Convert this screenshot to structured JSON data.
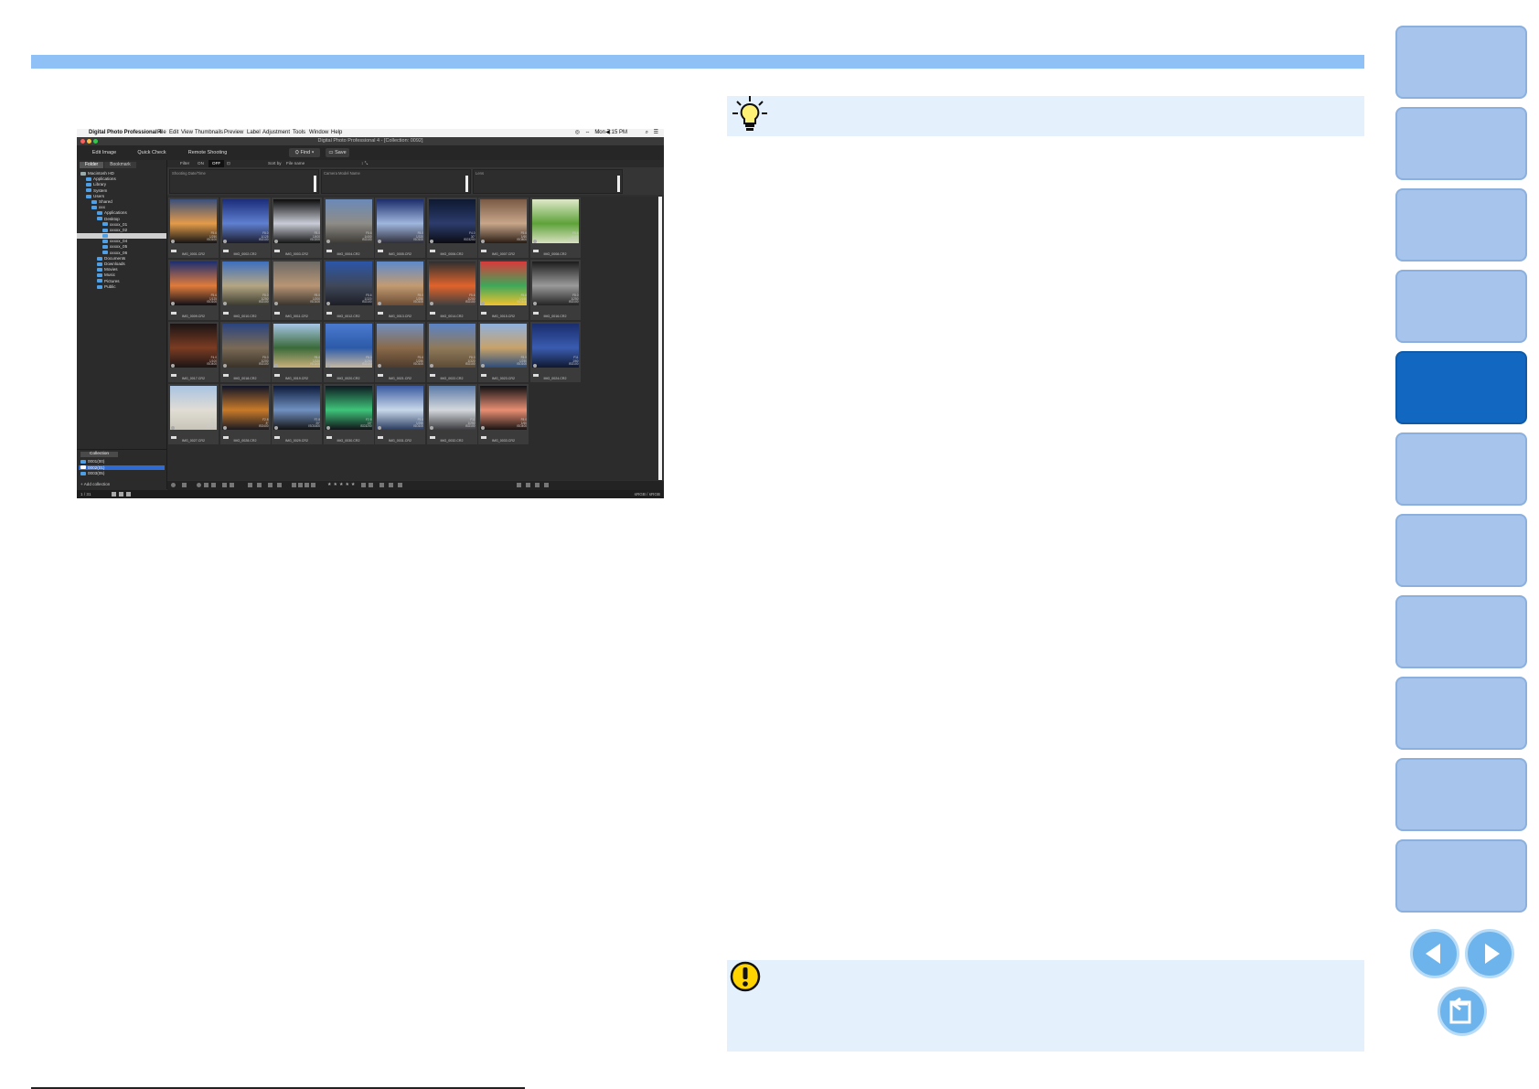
{
  "menubar": {
    "app_name": "Digital Photo Professional 4",
    "items": [
      "File",
      "Edit",
      "View",
      "Thumbnails",
      "Preview",
      "Label",
      "Adjustment",
      "Tools",
      "Window",
      "Help"
    ],
    "clock": "Mon 7:15 PM"
  },
  "window": {
    "title": "Digital Photo Professional 4 - [Collection: 0092]"
  },
  "toolbar": {
    "edit_image": "Edit Image",
    "quick_check": "Quick Check",
    "remote_shooting": "Remote Shooting",
    "find": "Find",
    "save": "Save"
  },
  "left_panel": {
    "tabs": [
      "Folder",
      "Bookmark"
    ],
    "tree": [
      {
        "label": "Macintosh HD",
        "indent": 0
      },
      {
        "label": "Applications",
        "indent": 1
      },
      {
        "label": "Library",
        "indent": 1
      },
      {
        "label": "System",
        "indent": 1
      },
      {
        "label": "Users",
        "indent": 1
      },
      {
        "label": "Shared",
        "indent": 2
      },
      {
        "label": "xxx",
        "indent": 2
      },
      {
        "label": "Applications",
        "indent": 3
      },
      {
        "label": "Desktop",
        "indent": 3
      },
      {
        "label": "xxxxx_01",
        "indent": 4
      },
      {
        "label": "xxxxx_02",
        "indent": 4
      },
      {
        "label": "",
        "indent": 4,
        "selected": true
      },
      {
        "label": "xxxxx_04",
        "indent": 4
      },
      {
        "label": "xxxxx_05",
        "indent": 4
      },
      {
        "label": "xxxxx_06",
        "indent": 4
      },
      {
        "label": "Documents",
        "indent": 3
      },
      {
        "label": "Downloads",
        "indent": 3
      },
      {
        "label": "Movies",
        "indent": 3
      },
      {
        "label": "Music",
        "indent": 3
      },
      {
        "label": "Pictures",
        "indent": 3
      },
      {
        "label": "Public",
        "indent": 3
      }
    ],
    "collection_tab": "Collection",
    "collections": [
      "0001(00)",
      "0002(01)",
      "0003(05)"
    ],
    "add_collection": "Add collection"
  },
  "filterbar": {
    "filter": "Filter",
    "on": "ON",
    "off": "OFF",
    "sort_by": "Sort by",
    "sort_value": "File name"
  },
  "filter_headers": [
    "Shooting Date/Time",
    "Camera Model Name",
    "Lens"
  ],
  "thumbnails": [
    {
      "name": "IMG_0001.CR2",
      "info": "F5.6\n1/250\nISO100",
      "colors": [
        "#3a4f7a",
        "#e39b4a",
        "#151515"
      ]
    },
    {
      "name": "IMG_0002.CR2",
      "info": "F8.0\n1/125\nISO100",
      "colors": [
        "#1b2d7a",
        "#5f7fd0",
        "#1c1c2c"
      ]
    },
    {
      "name": "IMG_0003.CR2",
      "info": "F8.0\n1/400\nISO200",
      "colors": [
        "#0c0c0c",
        "#c9ccd6",
        "#151515"
      ]
    },
    {
      "name": "IMG_0004.CR2",
      "info": "F5.6\n1/400\nISO100",
      "colors": [
        "#6a8ab8",
        "#8e8c86",
        "#3d3a36"
      ]
    },
    {
      "name": "IMG_0005.CR2",
      "info": "F8.0\n1/320\nISO100",
      "colors": [
        "#1b2c6a",
        "#9fb6de",
        "#2f2f3a"
      ]
    },
    {
      "name": "IMG_0006.CR2",
      "info": "F4.0\n30\"\nISO3200",
      "colors": [
        "#0e1830",
        "#2c3c6c",
        "#0b0b12"
      ]
    },
    {
      "name": "IMG_0007.CR2",
      "info": "F5.6\n1/60\nISO800",
      "colors": [
        "#7a5a44",
        "#c7a68a",
        "#2a1c14"
      ]
    },
    {
      "name": "IMG_0008.CR2",
      "info": "F5.6\n1/100\nISO400",
      "colors": [
        "#dfe9c8",
        "#5fa23a",
        "#d8e2c0"
      ]
    },
    {
      "name": "IMG_0009.CR2",
      "info": "F5.6\n1/125\nISO100",
      "colors": [
        "#1c2f70",
        "#e07b3c",
        "#101018"
      ]
    },
    {
      "name": "IMG_0010.CR2",
      "info": "F8.0\n1/250\nISO100",
      "colors": [
        "#3d6fbf",
        "#b4a684",
        "#3d3c30"
      ]
    },
    {
      "name": "IMG_0011.CR2",
      "info": "F8.0\n1/200\nISO100",
      "colors": [
        "#6d6a66",
        "#b89574",
        "#39352e"
      ]
    },
    {
      "name": "IMG_0012.CR2",
      "info": "F5.6\n1/320\nISO100",
      "colors": [
        "#2b56a8",
        "#3f4758",
        "#1d1e26"
      ]
    },
    {
      "name": "IMG_0013.CR2",
      "info": "F8.0\n1/250\nISO100",
      "colors": [
        "#5d8acc",
        "#c39b72",
        "#6b4c34"
      ]
    },
    {
      "name": "IMG_0014.CR2",
      "info": "F5.6\n1/200\nISO100",
      "colors": [
        "#2f2f30",
        "#e0632c",
        "#3f3f3f"
      ]
    },
    {
      "name": "IMG_0015.CR2",
      "info": "F5.6\n1/160\nISO100",
      "colors": [
        "#d93a3a",
        "#3fa75a",
        "#f0c22f"
      ]
    },
    {
      "name": "IMG_0016.CR2",
      "info": "F8.0\n1/250\nISO100",
      "colors": [
        "#1c1c1c",
        "#9a9a9a",
        "#242424"
      ]
    },
    {
      "name": "IMG_0017.CR2",
      "info": "F4.0\n1/100\nISO400",
      "colors": [
        "#1a1414",
        "#7b3c22",
        "#1c1515"
      ]
    },
    {
      "name": "IMG_0018.CR2",
      "info": "F8.0\n1/200\nISO100",
      "colors": [
        "#2a4480",
        "#7a6a56",
        "#3a3228"
      ]
    },
    {
      "name": "IMG_0019.CR2",
      "info": "F8.0\n1/320\nISO100",
      "colors": [
        "#a7c6e6",
        "#3b6a3a",
        "#c9b07c"
      ]
    },
    {
      "name": "IMG_0020.CR2",
      "info": "F8.0\n1/250\nISO100",
      "colors": [
        "#4a7ad0",
        "#2d5aa8",
        "#c7b9a2"
      ]
    },
    {
      "name": "IMG_0021.CR2",
      "info": "F5.6\n1/250\nISO100",
      "colors": [
        "#6f8fc0",
        "#8a6a4a",
        "#4d3b2c"
      ]
    },
    {
      "name": "IMG_0022.CR2",
      "info": "F8.0\n1/320\nISO100",
      "colors": [
        "#5b83c6",
        "#8f7a5a",
        "#5d4b36"
      ]
    },
    {
      "name": "IMG_0023.CR2",
      "info": "F8.0\n1/250\nISO100",
      "colors": [
        "#8fb1de",
        "#c8a26a",
        "#2c4c7a"
      ]
    },
    {
      "name": "IMG_0024.CR2",
      "info": "F11\n1/60\nISO100",
      "colors": [
        "#1a2d6c",
        "#3a5cb0",
        "#0f1830"
      ]
    },
    {
      "name": "IMG_0027.CR2",
      "info": "F8.0\n1/320\nISO100",
      "colors": [
        "#a9c3e2",
        "#e0ddd4",
        "#c8c4b8"
      ]
    },
    {
      "name": "IMG_0028.CR2",
      "info": "F2.8\n8\"\nISO400",
      "colors": [
        "#0f1428",
        "#c97a2a",
        "#1a1a22"
      ]
    },
    {
      "name": "IMG_0029.CR2",
      "info": "F2.8\n20\"\nISO1600",
      "colors": [
        "#0c1a3a",
        "#7090c0",
        "#121212"
      ]
    },
    {
      "name": "IMG_0030.CR2",
      "info": "F2.8\n15\"\nISO3200",
      "colors": [
        "#0e1a20",
        "#3fc47a",
        "#101418"
      ]
    },
    {
      "name": "IMG_0031.CR2",
      "info": "F5.6\n1/250\nISO100",
      "colors": [
        "#3a5aa0",
        "#c8d8ea",
        "#2a3c60"
      ]
    },
    {
      "name": "IMG_0032.CR2",
      "info": "F11\n1/250\nISO100",
      "colors": [
        "#5a7aa8",
        "#d4d8dc",
        "#3c3c40"
      ]
    },
    {
      "name": "IMG_0033.CR2",
      "info": "F8.0\n1/60\nISO400",
      "colors": [
        "#101014",
        "#e88e72",
        "#1a1414"
      ]
    }
  ],
  "statusbar": {
    "count": "1 / 31",
    "right": "sRGB / sRGB"
  },
  "colors": {
    "accent_rule": "#8fc0f6",
    "note_background": "#e4f0fc",
    "nav_tab": "#a6c4ec",
    "nav_tab_active": "#1268c0",
    "nav_button": "#6db4ec"
  },
  "nav": {
    "tabs": 11,
    "active_index": 4,
    "icons": [
      "tip-lightbulb-icon",
      "caution-exclamation-icon",
      "prev-page-icon",
      "next-page-icon",
      "return-icon"
    ]
  }
}
